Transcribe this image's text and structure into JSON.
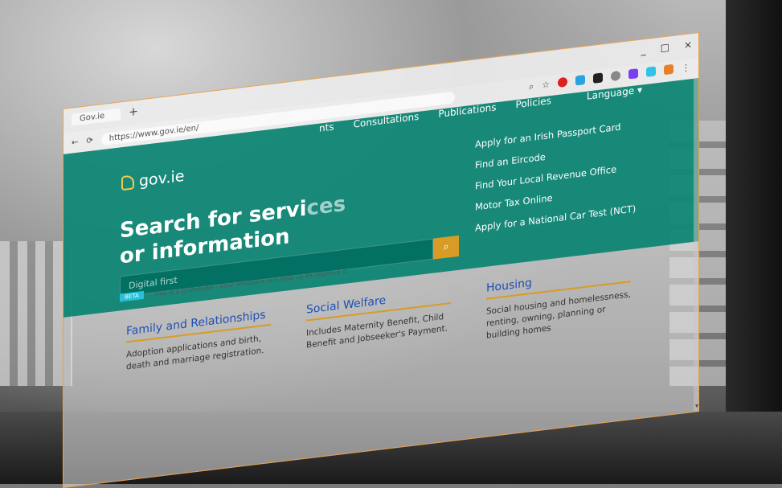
{
  "browser": {
    "tab_title": "Gov.ie",
    "new_tab_symbol": "+",
    "url": "https://www.gov.ie/en/",
    "window_controls": [
      "_",
      "□",
      "×"
    ]
  },
  "site": {
    "logo_text": "gov.ie",
    "nav": [
      "Consultations",
      "Publications",
      "Policies"
    ],
    "nav_partial": "nts",
    "language": "Language",
    "headline_line1": "Search for servi",
    "headline_line1_tail": "ces",
    "headline_line2": "or information",
    "search_placeholder": "Digital first",
    "quick_links": [
      "Apply for an Irish Passport Card",
      "Find an Eircode",
      "Find Your Local Revenue Office",
      "Motor Tax Online",
      "Apply for a National Car Test (NCT)"
    ],
    "beta_badge": "BETA",
    "beta_text": "This is a prototype - your feedback will help us to improve it.",
    "cards": [
      {
        "title": "Family and Relationships",
        "description": "Adoption applications and birth, death and marriage registration."
      },
      {
        "title": "Social Welfare",
        "description": "Includes Maternity Benefit, Child Benefit and Jobseeker's Payment."
      },
      {
        "title": "Housing",
        "description": "Social housing and homelessness, renting, owning, planning or building homes"
      }
    ]
  },
  "colors": {
    "brand_green": "#00816e",
    "accent_gold": "#d89b25",
    "card_title_blue": "#1f4fb3",
    "window_border": "#e7a24a"
  }
}
